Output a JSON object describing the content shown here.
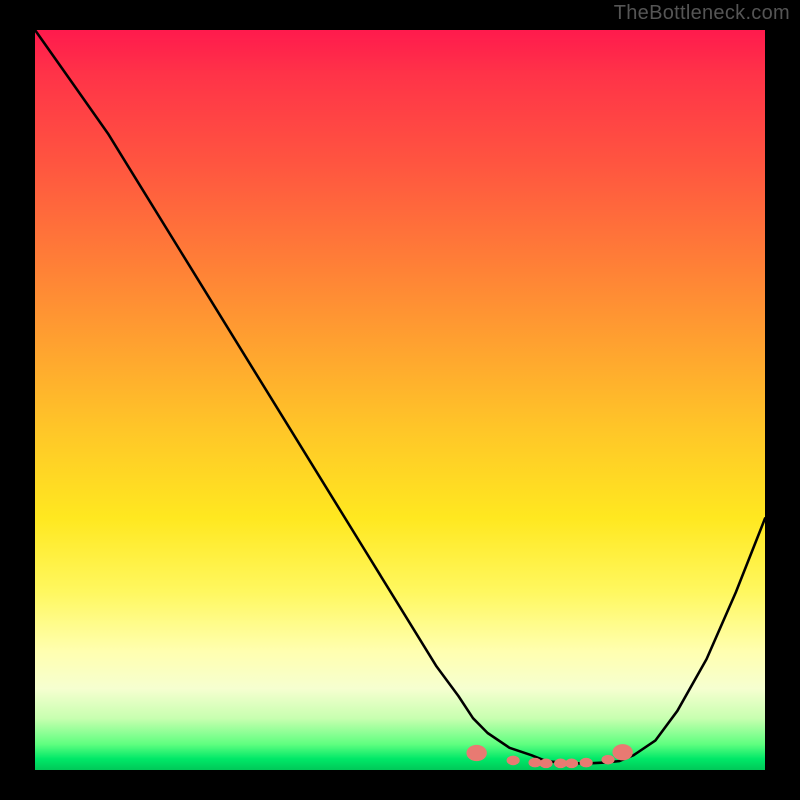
{
  "watermark": "TheBottleneck.com",
  "chart_data": {
    "type": "line",
    "title": "",
    "xlabel": "",
    "ylabel": "",
    "xlim": [
      0,
      100
    ],
    "ylim": [
      0,
      100
    ],
    "series": [
      {
        "name": "curve",
        "color": "#000000",
        "x": [
          0,
          5,
          10,
          15,
          20,
          25,
          30,
          35,
          40,
          45,
          50,
          55,
          58,
          60,
          62,
          65,
          68,
          70,
          72,
          74,
          76,
          78,
          80,
          82,
          85,
          88,
          92,
          96,
          100
        ],
        "y": [
          100,
          93,
          86,
          78,
          70,
          62,
          54,
          46,
          38,
          30,
          22,
          14,
          10,
          7,
          5,
          3,
          2,
          1.2,
          1,
          0.9,
          0.9,
          1,
          1.2,
          2,
          4,
          8,
          15,
          24,
          34
        ]
      }
    ],
    "markers": {
      "name": "dots",
      "color": "#e87a72",
      "points": [
        {
          "x": 60.5,
          "y": 2.3
        },
        {
          "x": 65.5,
          "y": 1.3
        },
        {
          "x": 68.5,
          "y": 1.0
        },
        {
          "x": 70.0,
          "y": 0.9
        },
        {
          "x": 72.0,
          "y": 0.9
        },
        {
          "x": 73.5,
          "y": 0.9
        },
        {
          "x": 75.5,
          "y": 1.0
        },
        {
          "x": 78.5,
          "y": 1.4
        },
        {
          "x": 80.5,
          "y": 2.4
        }
      ]
    },
    "gradient_colors": {
      "top": "#ff1a4d",
      "mid": "#ffe820",
      "bottom": "#00c858"
    }
  }
}
